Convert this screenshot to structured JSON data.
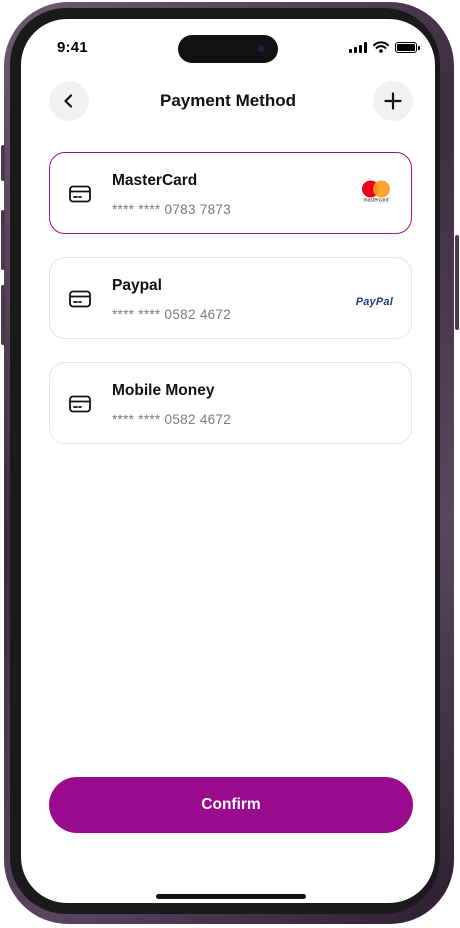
{
  "status_bar": {
    "time": "9:41"
  },
  "header": {
    "title": "Payment Method",
    "back_icon": "chevron-left-icon",
    "add_icon": "plus-icon"
  },
  "payment_methods": [
    {
      "name": "MasterCard",
      "number": "**** **** 0783 7873",
      "brand": "mastercard",
      "brand_label": "mastercard",
      "selected": true
    },
    {
      "name": "Paypal",
      "number": "**** **** 0582 4672",
      "brand": "paypal",
      "brand_label": "PayPal",
      "selected": false
    },
    {
      "name": "Mobile Money",
      "number": "**** **** 0582 4672",
      "brand": "",
      "selected": false
    }
  ],
  "confirm_label": "Confirm",
  "colors": {
    "accent": "#9a0a8e",
    "selected_border": "#8e1a8e",
    "mastercard_red": "#eb001b",
    "mastercard_orange": "#f79e1b",
    "paypal_dark": "#253b80",
    "paypal_light": "#179bd7"
  }
}
